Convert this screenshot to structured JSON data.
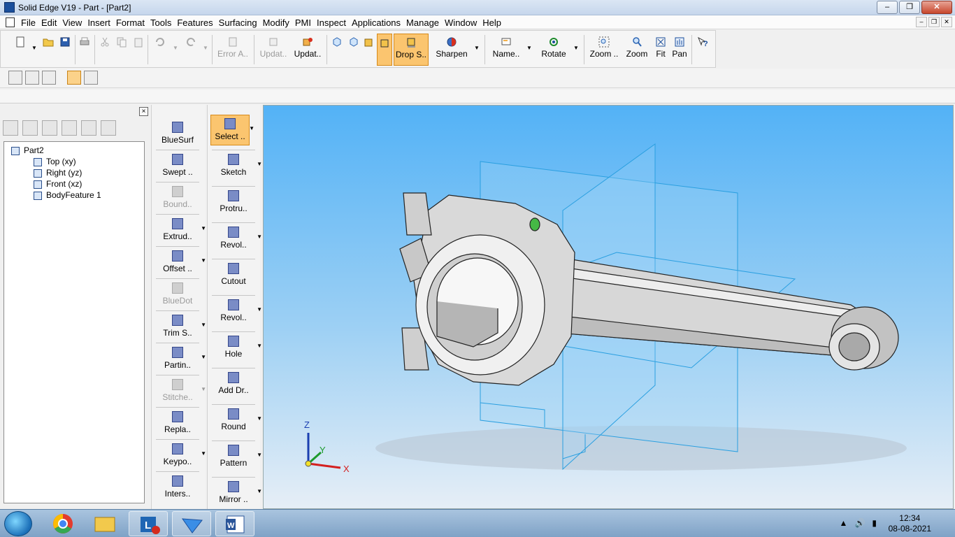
{
  "window": {
    "title": "Solid Edge V19 - Part - [Part2]"
  },
  "menu": [
    "File",
    "Edit",
    "View",
    "Insert",
    "Format",
    "Tools",
    "Features",
    "Surfacing",
    "Modify",
    "PMI",
    "Inspect",
    "Applications",
    "Manage",
    "Window",
    "Help"
  ],
  "toolbar": {
    "error_label": "Error A..",
    "update1_label": "Updat..",
    "update2_label": "Updat..",
    "drop_label": "Drop S..",
    "sharpen_label": "Sharpen",
    "name_label": "Name..",
    "rotate_label": "Rotate",
    "zoom_area_label": "Zoom ..",
    "zoom_label": "Zoom",
    "fit_label": "Fit",
    "pan_label": "Pan"
  },
  "pathfinder": {
    "close": "×",
    "tree": [
      {
        "label": "Part2",
        "level": 0
      },
      {
        "label": "Top (xy)",
        "level": 1
      },
      {
        "label": "Right (yz)",
        "level": 1
      },
      {
        "label": "Front (xz)",
        "level": 1
      },
      {
        "label": "BodyFeature 1",
        "level": 1
      }
    ]
  },
  "surface_features": [
    {
      "label": "BlueSurf",
      "disabled": false,
      "dropdown": false
    },
    {
      "label": "Swept ..",
      "disabled": false,
      "dropdown": false
    },
    {
      "label": "Bound..",
      "disabled": true,
      "dropdown": false
    },
    {
      "label": "Extrud..",
      "disabled": false,
      "dropdown": true
    },
    {
      "label": "Offset ..",
      "disabled": false,
      "dropdown": true
    },
    {
      "label": "BlueDot",
      "disabled": true,
      "dropdown": false
    },
    {
      "label": "Trim S..",
      "disabled": false,
      "dropdown": true
    },
    {
      "label": "Partin..",
      "disabled": false,
      "dropdown": true
    },
    {
      "label": "Stitche..",
      "disabled": true,
      "dropdown": true
    },
    {
      "label": "Repla..",
      "disabled": false,
      "dropdown": false
    },
    {
      "label": "Keypo..",
      "disabled": false,
      "dropdown": true
    },
    {
      "label": "Inters..",
      "disabled": false,
      "dropdown": false
    }
  ],
  "solid_features": [
    {
      "label": "Select ..",
      "dropdown": true
    },
    {
      "label": "Sketch",
      "dropdown": true
    },
    {
      "label": "Protru..",
      "dropdown": false
    },
    {
      "label": "Revol..",
      "dropdown": true
    },
    {
      "label": "Cutout",
      "dropdown": false
    },
    {
      "label": "Revol..",
      "dropdown": true
    },
    {
      "label": "Hole",
      "dropdown": true
    },
    {
      "label": "Add Dr..",
      "dropdown": false
    },
    {
      "label": "Round",
      "dropdown": true
    },
    {
      "label": "Pattern",
      "dropdown": true
    },
    {
      "label": "Mirror ..",
      "dropdown": true
    }
  ],
  "viewport": {
    "axis_x": "X",
    "axis_y": "Y",
    "axis_z": "Z"
  },
  "taskbar": {
    "time": "12:34",
    "date": "08-08-2021"
  },
  "colors": {
    "accent_orange": "#fbc56f",
    "viewport_top": "#53b2f6",
    "viewport_bottom": "#e6eef6",
    "plane_line": "#2a9fe0"
  }
}
